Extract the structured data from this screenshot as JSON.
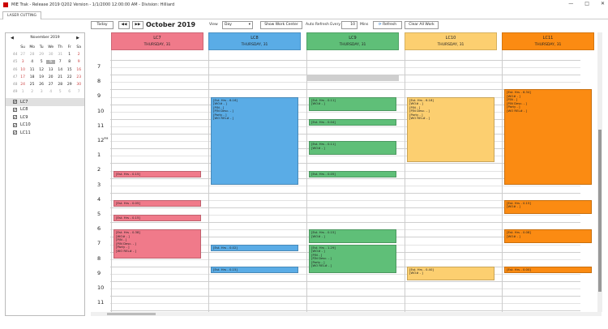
{
  "window": {
    "title": "MIE Trak - Release 2019 Q202 Version - 1/1/2000 12:00:00 AM - Division: Hilliard",
    "controls": [
      "—",
      "□",
      "✕"
    ]
  },
  "tabs": [
    {
      "label": "LASER CUTTING"
    }
  ],
  "toolbar": {
    "today": "Today",
    "prev": "◀◀",
    "next": "▶▶",
    "month_title": "October 2019",
    "view_label": "View",
    "view_value": "Day",
    "show_wc": "Show Work Center",
    "auto_refresh": "Auto Refresh Every",
    "refresh_value": "10",
    "mins": "Mins",
    "refresh": "Refresh",
    "clear": "Clear All Work"
  },
  "mini_calendar": {
    "title": "November 2019",
    "prev": "◀",
    "next": "▶",
    "weekdays": [
      "Su",
      "Mo",
      "Tu",
      "We",
      "Th",
      "Fr",
      "Sa"
    ],
    "weeks": [
      {
        "wk": "44",
        "days": [
          "27",
          "28",
          "29",
          "30",
          "31",
          "1",
          "2"
        ]
      },
      {
        "wk": "45",
        "days": [
          "3",
          "4",
          "5",
          "6",
          "7",
          "8",
          "9"
        ]
      },
      {
        "wk": "46",
        "days": [
          "10",
          "11",
          "12",
          "13",
          "14",
          "15",
          "16"
        ]
      },
      {
        "wk": "47",
        "days": [
          "17",
          "18",
          "19",
          "20",
          "21",
          "22",
          "23"
        ]
      },
      {
        "wk": "48",
        "days": [
          "24",
          "25",
          "26",
          "27",
          "28",
          "29",
          "30"
        ]
      },
      {
        "wk": "49",
        "days": [
          "1",
          "2",
          "3",
          "4",
          "5",
          "6",
          "7"
        ]
      }
    ]
  },
  "resources": [
    {
      "label": "LC7",
      "checked": "✔"
    },
    {
      "label": "LC8",
      "checked": "✔"
    },
    {
      "label": "LC9",
      "checked": "✔"
    },
    {
      "label": "LC10",
      "checked": "✔"
    },
    {
      "label": "LC11",
      "checked": "✔"
    }
  ],
  "columns": [
    {
      "name": "LC7",
      "day": "THURSDAY, 31",
      "color": "#f07a8a"
    },
    {
      "name": "LC8",
      "day": "THURSDAY, 31",
      "color": "#5aace6"
    },
    {
      "name": "LC9",
      "day": "THURSDAY, 31",
      "color": "#5fbf78"
    },
    {
      "name": "LC10",
      "day": "THURSDAY, 31",
      "color": "#fccf70"
    },
    {
      "name": "LC11",
      "day": "THURSDAY, 31",
      "color": "#fb8b12"
    }
  ],
  "hours": [
    {
      "h": "7",
      "s": ""
    },
    {
      "h": "8",
      "s": ""
    },
    {
      "h": "9",
      "s": ""
    },
    {
      "h": "10",
      "s": ""
    },
    {
      "h": "11",
      "s": ""
    },
    {
      "h": "12",
      "s": "PM"
    },
    {
      "h": "1",
      "s": ""
    },
    {
      "h": "2",
      "s": ""
    },
    {
      "h": "3",
      "s": ""
    },
    {
      "h": "4",
      "s": ""
    },
    {
      "h": "5",
      "s": ""
    },
    {
      "h": "6",
      "s": ""
    },
    {
      "h": "7",
      "s": ""
    },
    {
      "h": "8",
      "s": ""
    },
    {
      "h": "9",
      "s": ""
    },
    {
      "h": "10",
      "s": ""
    },
    {
      "h": "11",
      "s": ""
    }
  ],
  "appointments": [
    {
      "col": 0,
      "start": 14.5,
      "end": 15,
      "lines": [
        "[Est. Hrs - 0.15]"
      ]
    },
    {
      "col": 0,
      "start": 16.5,
      "end": 17,
      "lines": [
        "[Est. Hrs - 0.05]"
      ]
    },
    {
      "col": 0,
      "start": 17.5,
      "end": 18,
      "lines": [
        "[Est. Hrs - 0.15]"
      ]
    },
    {
      "col": 0,
      "start": 18.5,
      "end": 20.5,
      "lines": [
        "[Est. Hrs - 0.38]",
        "[WO# - ]",
        "[P/N - ]",
        "[P/N Desc. - ]",
        "[Party - ]",
        "[WO REL# - ]"
      ]
    },
    {
      "col": 1,
      "start": 9.5,
      "end": 15.5,
      "lines": [
        "[Est. Hrs - 6.16]",
        "[WO# - ]",
        "[P/N - ]",
        "[P/N Desc. - ]",
        "[Party - ]",
        "[WO REL# - ]"
      ]
    },
    {
      "col": 1,
      "start": 19.5,
      "end": 20,
      "lines": [
        "[Est. Hrs - 0.02]"
      ]
    },
    {
      "col": 1,
      "start": 21,
      "end": 21.5,
      "lines": [
        "[Est. Hrs - 0.15]"
      ]
    },
    {
      "col": 2,
      "start": 9.5,
      "end": 10.5,
      "lines": [
        "[Est. Hrs - 0.11]",
        "[WO# - ]"
      ]
    },
    {
      "col": 2,
      "start": 11,
      "end": 11.5,
      "lines": [
        "[Est. Hrs - 0.04]"
      ]
    },
    {
      "col": 2,
      "start": 12.5,
      "end": 13.5,
      "lines": [
        "[Est. Hrs - 0.11]",
        "[WO# - ]"
      ]
    },
    {
      "col": 2,
      "start": 14.5,
      "end": 15,
      "lines": [
        "[Est. Hrs - 0.05]"
      ]
    },
    {
      "col": 2,
      "start": 18.5,
      "end": 19.5,
      "lines": [
        "[Est. Hrs - 0.15]",
        "[WO# - ]"
      ]
    },
    {
      "col": 2,
      "start": 19.5,
      "end": 21.5,
      "lines": [
        "[Est. Hrs - 1.29]",
        "[WO# - ]",
        "[P/N - ]",
        "[P/N Desc. - ]",
        "[Party - ]",
        "[WO REL# - ]"
      ]
    },
    {
      "col": 3,
      "start": 9.5,
      "end": 14,
      "lines": [
        "[Est. Hrs - 6.18]",
        "[WO# - ]",
        "[P/N - ]",
        "[P/N Desc. - ]",
        "[Party - ]",
        "[WO REL# - ]"
      ]
    },
    {
      "col": 3,
      "start": 21,
      "end": 22,
      "lines": [
        "[Est. Hrs - 0.40]",
        "[WO# - ]"
      ]
    },
    {
      "col": 4,
      "start": 9,
      "end": 15.5,
      "lines": [
        "[Est. Hrs - 6.34]",
        "[WO# - ]",
        "[P/N - ]",
        "[P/N Desc. - ]",
        "[Party - ]",
        "[WO REL# - ]"
      ]
    },
    {
      "col": 4,
      "start": 16.5,
      "end": 17.5,
      "lines": [
        "[Est. Hrs - 0.15]",
        "[WO# - ]"
      ]
    },
    {
      "col": 4,
      "start": 18.5,
      "end": 19.5,
      "lines": [
        "[Est. Hrs - 0.08]",
        "[WO# - ]"
      ]
    },
    {
      "col": 4,
      "start": 21,
      "end": 21.5,
      "lines": [
        "[Est. Hrs - 0.00]"
      ]
    }
  ]
}
